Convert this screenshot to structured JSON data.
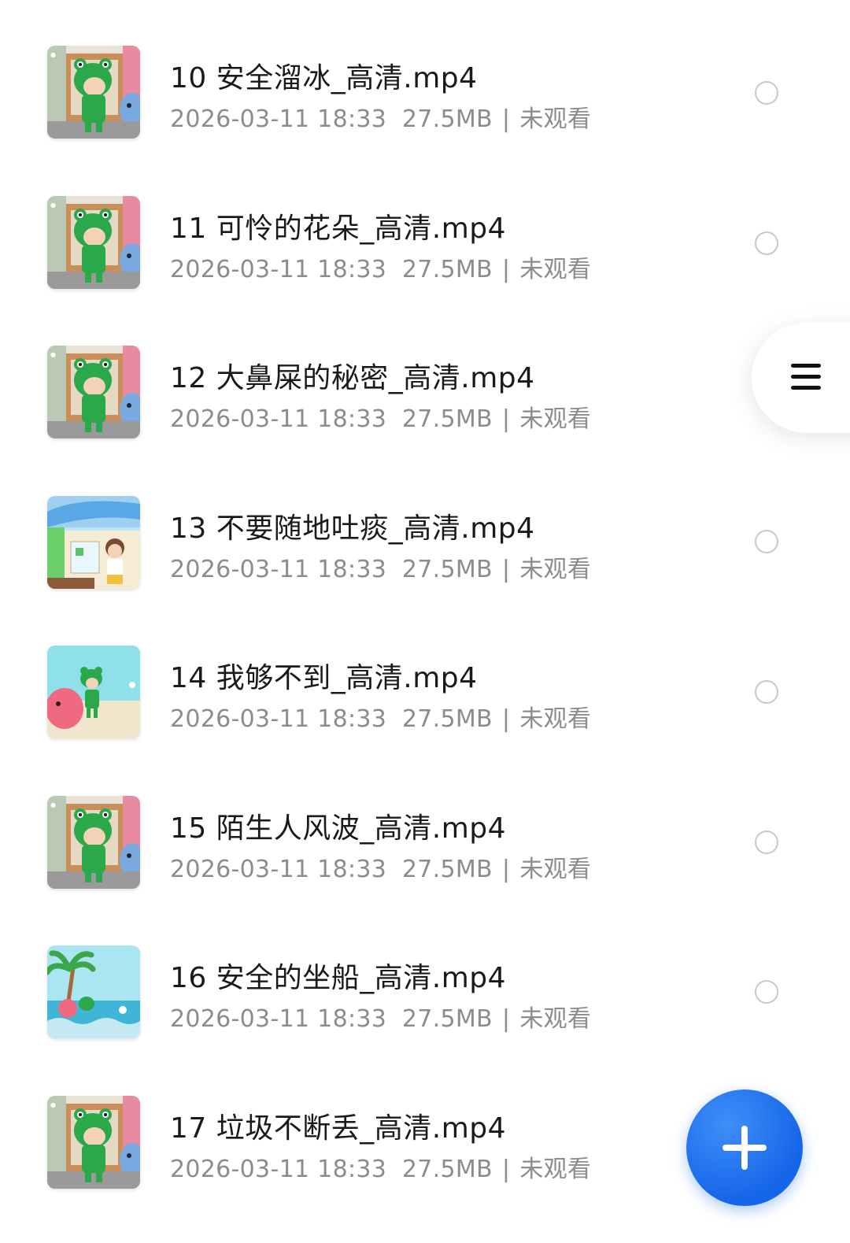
{
  "accent_color": "#1466e8",
  "side_menu_icon": "menu-icon",
  "fab_icon": "plus-icon",
  "files": [
    {
      "name": "10 安全溜冰_高清.mp4",
      "date": "2026-03-11 18:33",
      "size": "27.5MB",
      "status": "未观看",
      "thumb": "frog"
    },
    {
      "name": "11 可怜的花朵_高清.mp4",
      "date": "2026-03-11 18:33",
      "size": "27.5MB",
      "status": "未观看",
      "thumb": "frog"
    },
    {
      "name": "12 大鼻屎的秘密_高清.mp4",
      "date": "2026-03-11 18:33",
      "size": "27.5MB",
      "status": "未观看",
      "thumb": "frog"
    },
    {
      "name": "13 不要随地吐痰_高清.mp4",
      "date": "2026-03-11 18:33",
      "size": "27.5MB",
      "status": "未观看",
      "thumb": "shop"
    },
    {
      "name": "14 我够不到_高清.mp4",
      "date": "2026-03-11 18:33",
      "size": "27.5MB",
      "status": "未观看",
      "thumb": "beach"
    },
    {
      "name": "15 陌生人风波_高清.mp4",
      "date": "2026-03-11 18:33",
      "size": "27.5MB",
      "status": "未观看",
      "thumb": "frog"
    },
    {
      "name": "16 安全的坐船_高清.mp4",
      "date": "2026-03-11 18:33",
      "size": "27.5MB",
      "status": "未观看",
      "thumb": "boat"
    },
    {
      "name": "17 垃圾不断丢_高清.mp4",
      "date": "2026-03-11 18:33",
      "size": "27.5MB",
      "status": "未观看",
      "thumb": "frog"
    }
  ]
}
